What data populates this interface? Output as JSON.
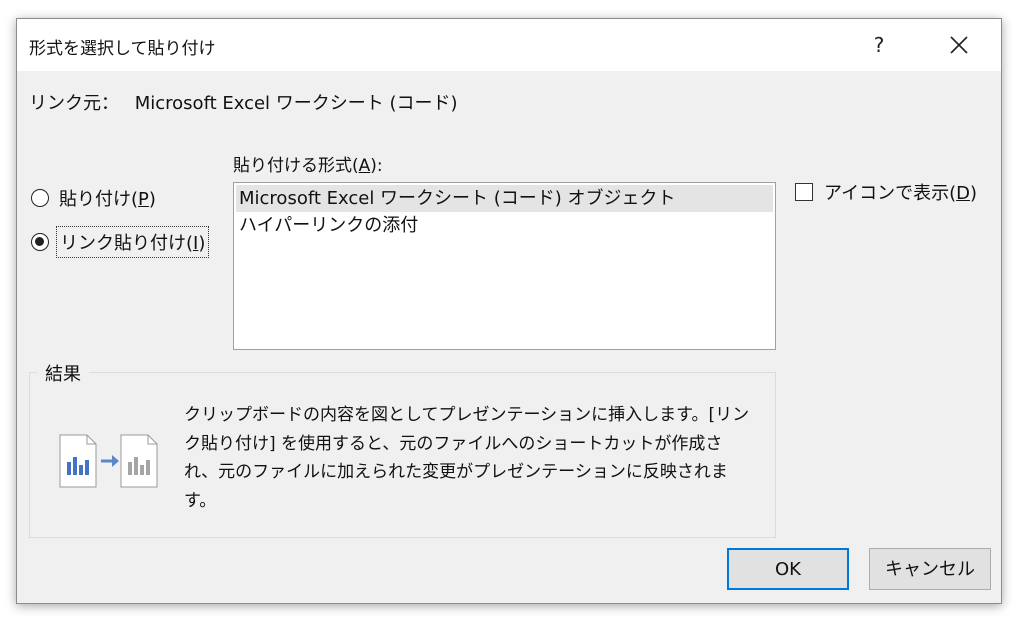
{
  "dialog": {
    "title": "形式を選択して貼り付け",
    "help": "?",
    "close_icon": "close-icon"
  },
  "source": {
    "label": "リンク元：",
    "name": "Microsoft Excel ワークシート (コード)"
  },
  "format_label": {
    "pre": "貼り付ける形式(",
    "key": "A",
    "post": "):"
  },
  "paste_options": [
    {
      "pre": "貼り付け(",
      "key": "P",
      "post": ")",
      "checked": false
    },
    {
      "pre": "リンク貼り付け(",
      "key": "I",
      "post": ")",
      "checked": true
    }
  ],
  "formats": [
    {
      "label": "Microsoft Excel ワークシート (コード) オブジェクト",
      "selected": true
    },
    {
      "label": "ハイパーリンクの添付",
      "selected": false
    }
  ],
  "display_as_icon": {
    "pre": "アイコンで表示(",
    "key": "D",
    "post": ")",
    "checked": false
  },
  "result": {
    "legend": "結果",
    "lines": [
      "クリップボードの内容を図としてプレゼンテーションに挿入します。[リン",
      "ク貼り付け] を使用すると、元のファイルへのショートカットが作成さ",
      "れ、元のファイルに加えられた変更がプレゼンテーションに反映されま",
      "す。"
    ],
    "illustration": "file-link-icon"
  },
  "buttons": {
    "ok": "OK",
    "cancel": "キャンセル"
  },
  "colors": {
    "accent": "#0078d7",
    "chart_bar_1": "#4472c4",
    "chart_bar_2": "#a5a5a5",
    "arrow": "#5b87c7"
  }
}
